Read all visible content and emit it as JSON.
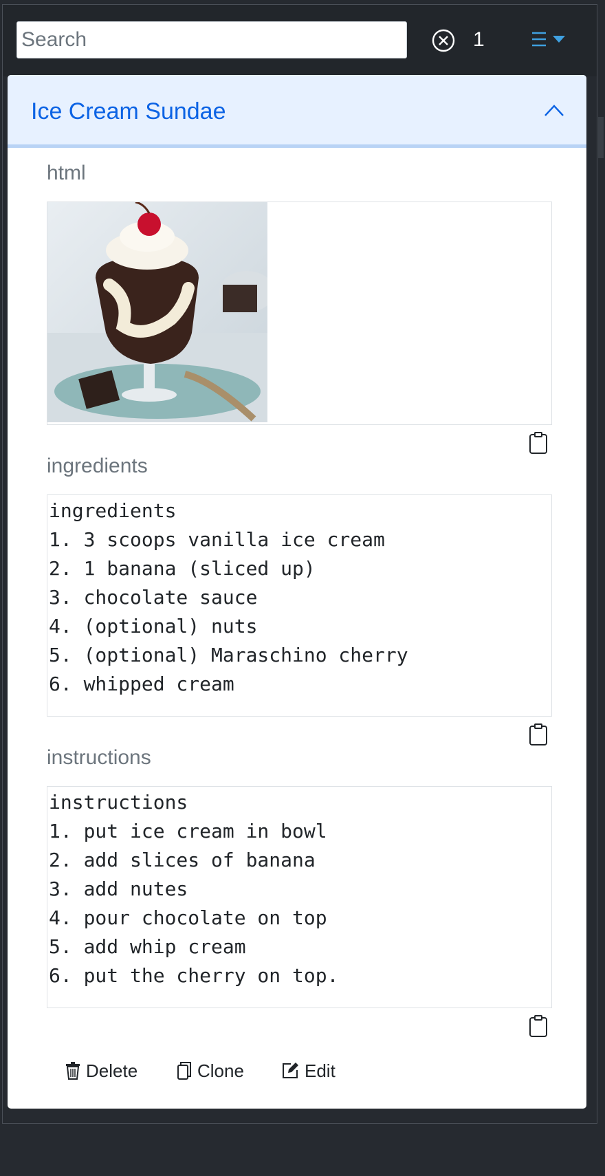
{
  "search": {
    "placeholder": "Search",
    "value": ""
  },
  "results": {
    "count": "1"
  },
  "card": {
    "title": "Ice Cream Sundae",
    "image_alt": "ice cream sundae photo",
    "sections": [
      {
        "label": "html"
      },
      {
        "label": "ingredients",
        "lines": [
          "ingredients",
          "1. 3 scoops vanilla ice cream",
          "2. 1 banana (sliced up)",
          "3. chocolate sauce",
          "4. (optional) nuts",
          "5. (optional) Maraschino cherry",
          "6. whipped cream"
        ]
      },
      {
        "label": "instructions",
        "lines": [
          "instructions",
          "1. put ice cream in bowl",
          "2. add slices of banana",
          "3. add nutes",
          "4. pour chocolate on top",
          "5. add whip cream",
          "6. put the cherry on top."
        ]
      }
    ],
    "actions": {
      "delete": "Delete",
      "clone": "Clone",
      "edit": "Edit"
    }
  },
  "colors": {
    "accent": "#0c63e4",
    "header_bg": "#22262b",
    "menu_icon": "#3fa0e0"
  },
  "icons": [
    "clear-icon",
    "menu-icon",
    "chevron-up-icon",
    "clipboard-icon",
    "trash-icon",
    "copy-icon",
    "edit-icon"
  ]
}
